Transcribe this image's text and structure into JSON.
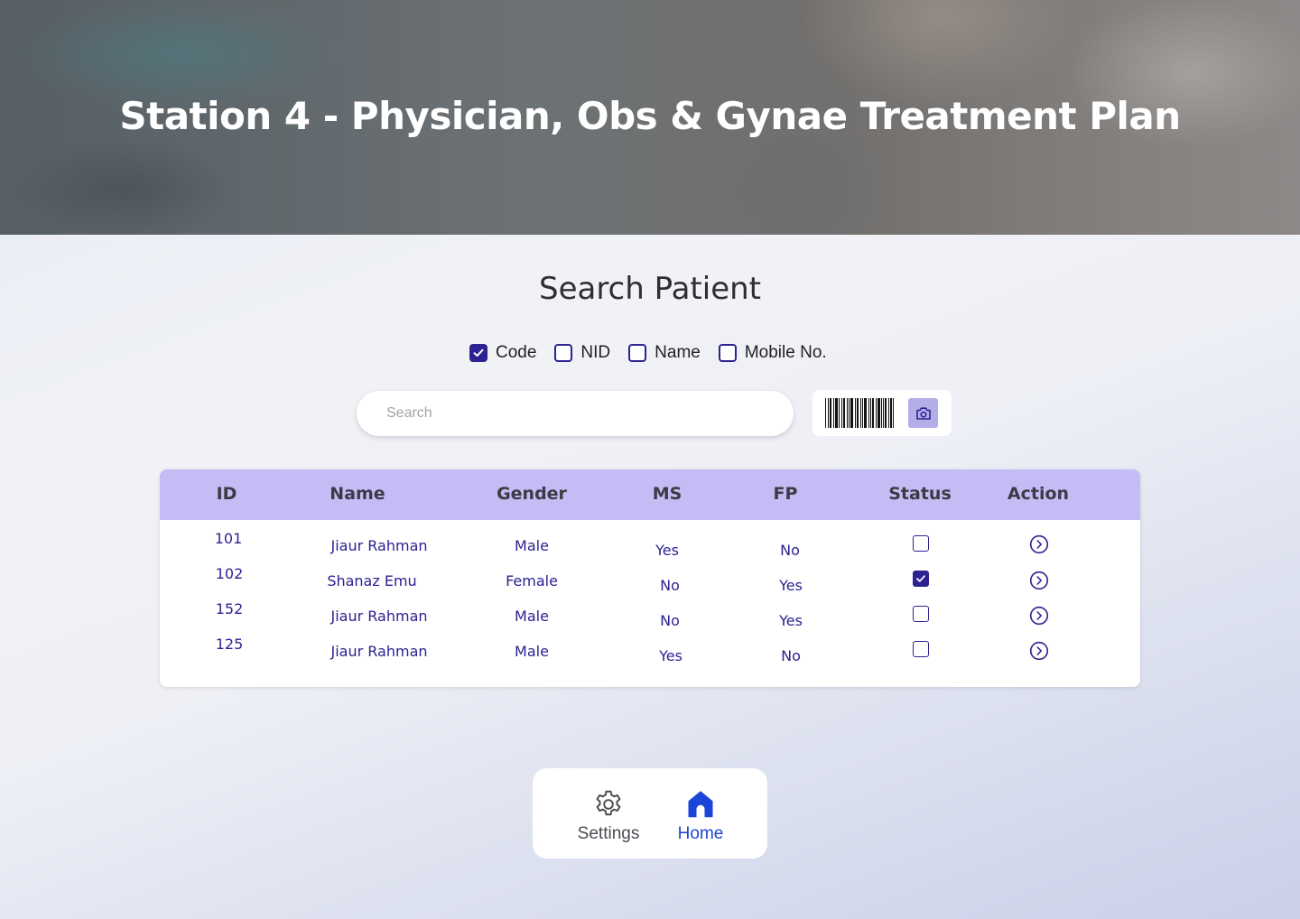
{
  "header": {
    "title": "Station 4 - Physician, Obs & Gynae Treatment Plan"
  },
  "search_section": {
    "title": "Search Patient",
    "filters": [
      {
        "label": "Code",
        "checked": true
      },
      {
        "label": "NID",
        "checked": false
      },
      {
        "label": "Name",
        "checked": false
      },
      {
        "label": "Mobile No.",
        "checked": false
      }
    ],
    "search_placeholder": "Search",
    "search_value": "",
    "barcode_icon": "barcode-icon",
    "camera_icon": "camera-icon"
  },
  "table": {
    "columns": [
      "ID",
      "Name",
      "Gender",
      "MS",
      "FP",
      "Status",
      "Action"
    ],
    "rows": [
      {
        "id": "101",
        "name": "Jiaur Rahman",
        "gender": "Male",
        "ms": "Yes",
        "fp": "No",
        "status": false
      },
      {
        "id": "102",
        "name": "Shanaz Emu",
        "gender": "Female",
        "ms": "No",
        "fp": "Yes",
        "status": true
      },
      {
        "id": "152",
        "name": "Jiaur Rahman",
        "gender": "Male",
        "ms": "No",
        "fp": "Yes",
        "status": false
      },
      {
        "id": "125",
        "name": "Jiaur Rahman",
        "gender": "Male",
        "ms": "Yes",
        "fp": "No",
        "status": false
      }
    ],
    "action_icon": "chevron-right-circle-icon"
  },
  "bottom_nav": {
    "items": [
      {
        "label": "Settings",
        "icon": "gear-icon",
        "active": false
      },
      {
        "label": "Home",
        "icon": "home-icon",
        "active": true
      }
    ]
  },
  "colors": {
    "accent": "#2c2291",
    "table_header": "#c4bcf4",
    "active_nav": "#1b45d8"
  }
}
